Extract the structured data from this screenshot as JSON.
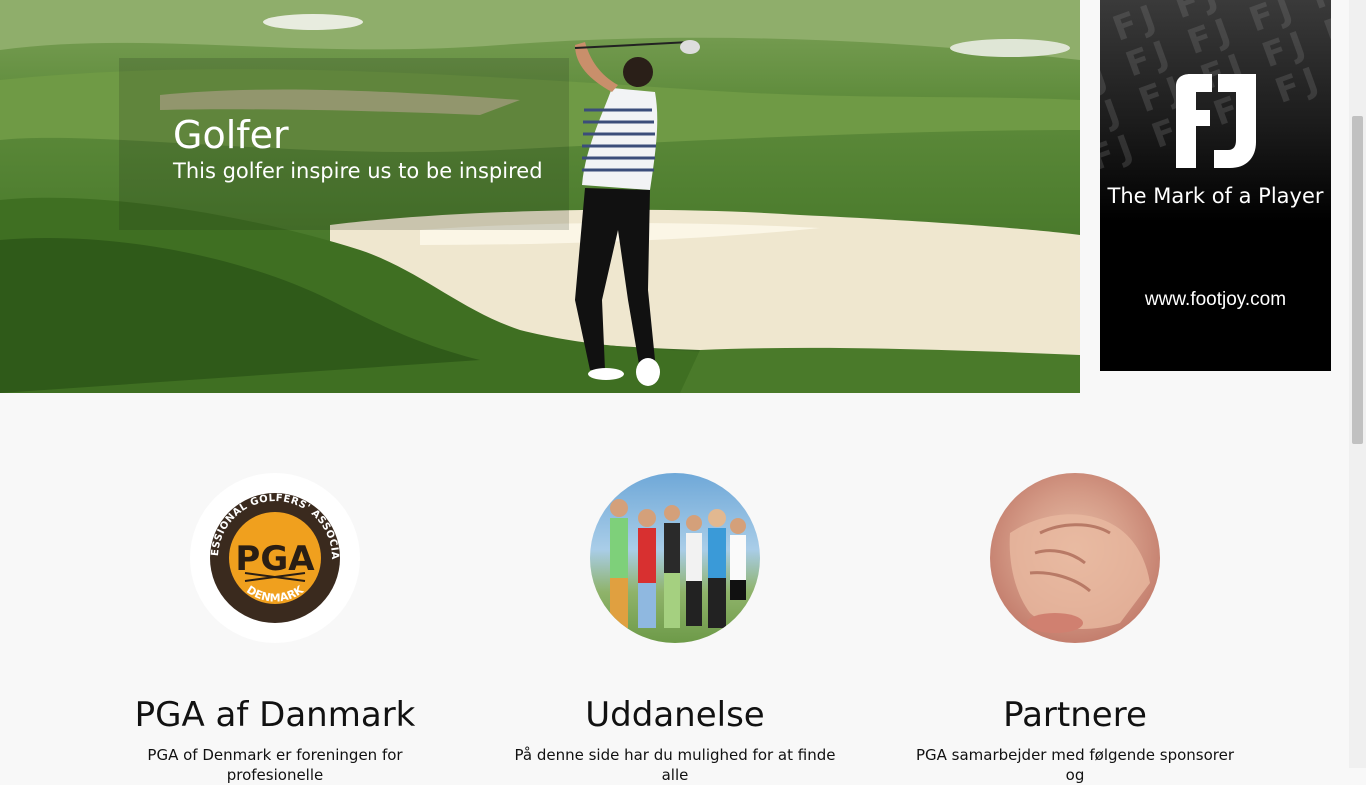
{
  "hero": {
    "title": "Golfer",
    "subtitle": "This golfer inspire us to be inspired"
  },
  "ad": {
    "logo": "FJ",
    "tagline": "The Mark of a Player",
    "url": "www.footjoy.com"
  },
  "features": [
    {
      "title": "PGA af Danmark",
      "text": "PGA of Denmark er foreningen for profesionelle"
    },
    {
      "title": "Uddanelse",
      "text": "På denne side har du mulighed for at finde alle"
    },
    {
      "title": "Partnere",
      "text": "PGA samarbejder med følgende sponsorer og"
    }
  ],
  "pga_logo": {
    "arc_text": "PROFESSIONAL GOLFERS' ASSOCIATION",
    "center": "PGA",
    "bottom": "DENMARK"
  },
  "colors": {
    "pga_orange": "#f0a01e",
    "pga_dark": "#3a2a1e",
    "ad_bg": "#000000"
  }
}
